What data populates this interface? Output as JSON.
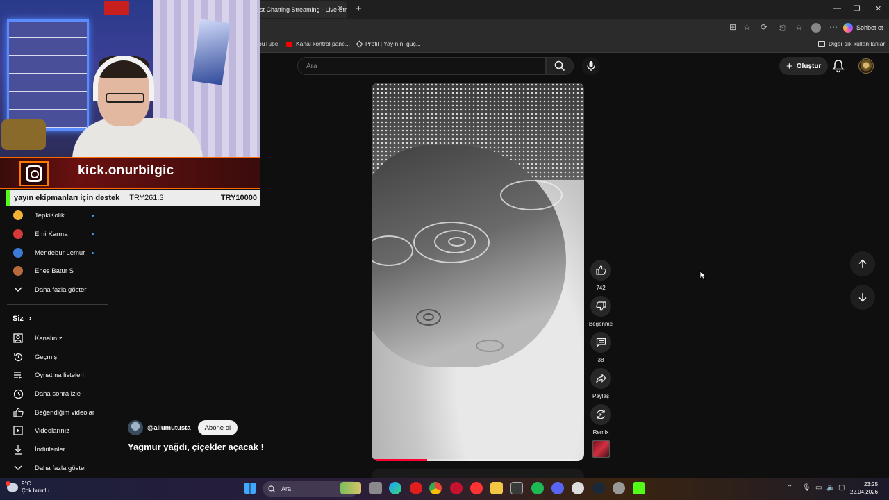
{
  "browser": {
    "tab_title": "st Chatting Streaming - Live Stre",
    "sohbet_label": "Sohbet et",
    "bookmarks": [
      {
        "label": "ouTube"
      },
      {
        "label": "Kanal kontrol pane..."
      },
      {
        "label": "Profil | Yayınını güç..."
      }
    ],
    "other_bookmarks": "Diğer sık kullanılanlar"
  },
  "youtube": {
    "search_placeholder": "Ara",
    "create_label": "Oluştur"
  },
  "overlay": {
    "kick_handle": "kick.onurbilgic",
    "donation_title": "yayın ekipmanları için destek",
    "donation_current": "TRY261.3",
    "donation_target": "TRY10000",
    "donation_progress": 0.026
  },
  "sidebar": {
    "subscriptions": [
      {
        "label": "TepkiKolik",
        "dot": true,
        "color": "#f2b233"
      },
      {
        "label": "EmirKarma",
        "dot": true,
        "color": "#d63a3a"
      },
      {
        "label": "Mendebur Lemur",
        "dot": true,
        "color": "#3a7bd6"
      },
      {
        "label": "Enes Batur S",
        "dot": false,
        "color": "#b86a3a"
      }
    ],
    "show_more_1": "Daha fazla göster",
    "you_heading": "Siz",
    "you_items": [
      {
        "label": "Kanalınız",
        "icon": "user-square-icon"
      },
      {
        "label": "Geçmiş",
        "icon": "history-icon"
      },
      {
        "label": "Oynatma listeleri",
        "icon": "playlist-icon"
      },
      {
        "label": "Daha sonra izle",
        "icon": "clock-icon"
      },
      {
        "label": "Beğendiğim videolar",
        "icon": "thumbs-up-icon"
      },
      {
        "label": "Videolarınız",
        "icon": "video-icon"
      },
      {
        "label": "İndirilenler",
        "icon": "download-icon"
      }
    ],
    "show_more_2": "Daha fazla göster"
  },
  "short": {
    "channel_name": "@aliumutusta",
    "subscribe_label": "Abone ol",
    "title": "Yağmur yağdı, çiçekler açacak !",
    "like_count": "742",
    "dislike_label": "Beğenme",
    "comment_count": "38",
    "share_label": "Paylaş",
    "remix_label": "Remix",
    "progress": 0.26
  },
  "taskbar": {
    "temperature": "9°C",
    "weather": "Çok bulutlu",
    "search_label": "Ara",
    "time": "23:25",
    "date": "22.04.2026",
    "accent": "#0078d4"
  }
}
